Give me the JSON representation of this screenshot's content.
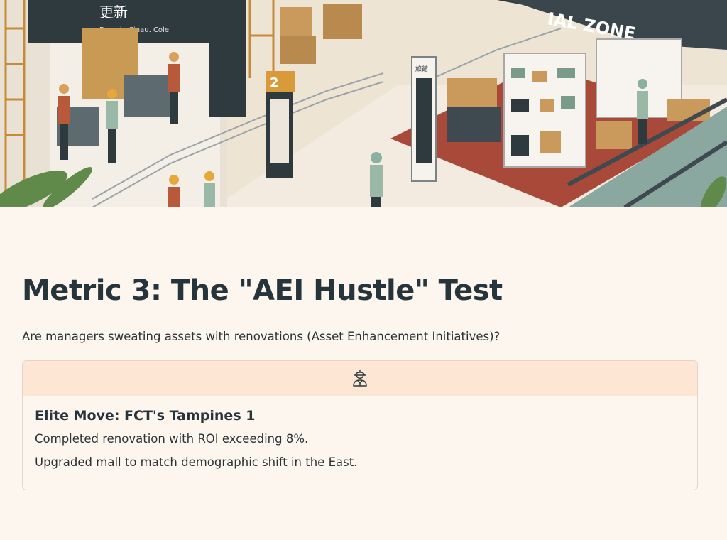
{
  "hero": {
    "sign_zone": "IAL ZONE",
    "sign_chinese": "更新",
    "sign_english": "Baacrip Cinau. Cole",
    "kiosk_number": "2",
    "kiosk_text": "旅館"
  },
  "section": {
    "title": "Metric 3: The \"AEI Hustle\" Test",
    "subtitle": "Are managers sweating assets with renovations (Asset Enhancement Initiatives)?"
  },
  "card": {
    "header_icon": "construction-worker-icon",
    "title": "Elite Move: FCT's Tampines 1",
    "lines": [
      "Completed renovation with ROI exceeding 8%.",
      "Upgraded mall to match demographic shift in the East."
    ]
  },
  "colors": {
    "background": "#fdf6ee",
    "card_header": "#fde6d4",
    "text": "#26343b"
  }
}
